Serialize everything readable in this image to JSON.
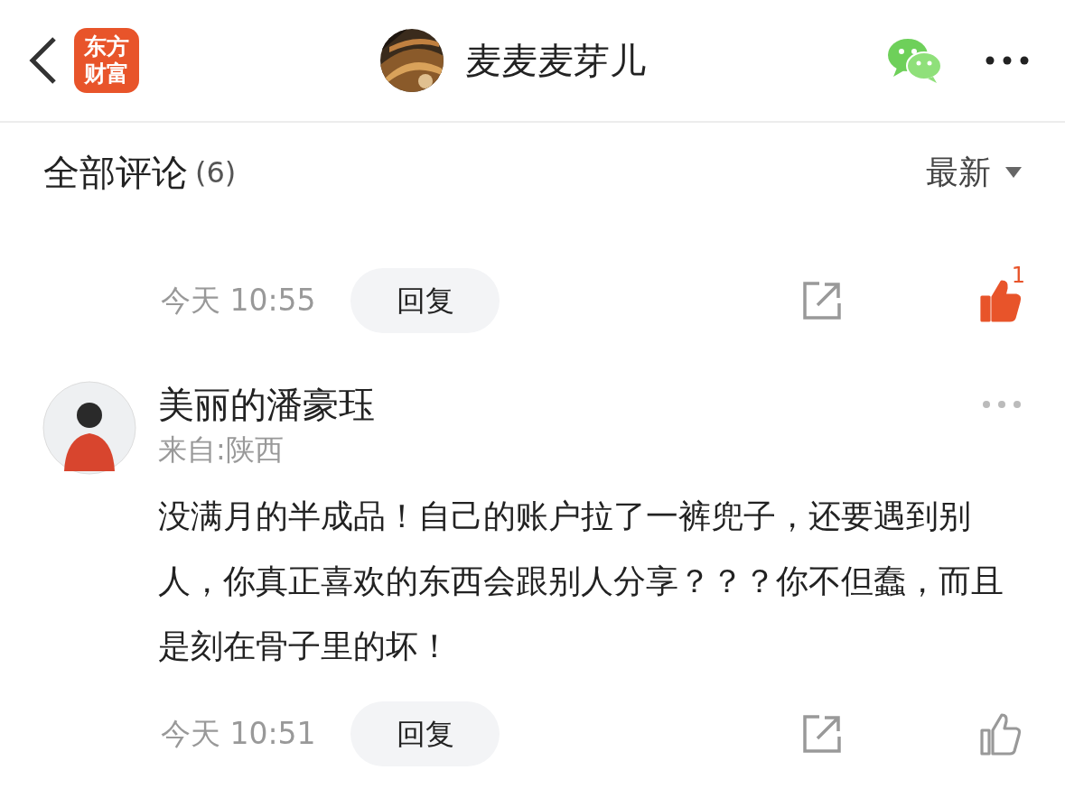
{
  "header": {
    "logo": [
      "东方",
      "财富"
    ],
    "title": "麦麦麦芽儿"
  },
  "comments_header": {
    "title": "全部评论",
    "count": "(6)",
    "sort": "最新"
  },
  "comments": [
    {
      "kind": "partial",
      "time": "今天 10:55",
      "reply": "回复",
      "liked": true,
      "like_count": "1"
    },
    {
      "kind": "full",
      "name": "美丽的潘豪珏",
      "location": "来自:陕西",
      "text": "没满月的半成品！自己的账户拉了一裤兜子，还要遇到别人，你真正喜欢的东西会跟别人分享？？？你不但蠢，而且是刻在骨子里的坏！",
      "time": "今天 10:51",
      "reply": "回复",
      "liked": false
    }
  ]
}
